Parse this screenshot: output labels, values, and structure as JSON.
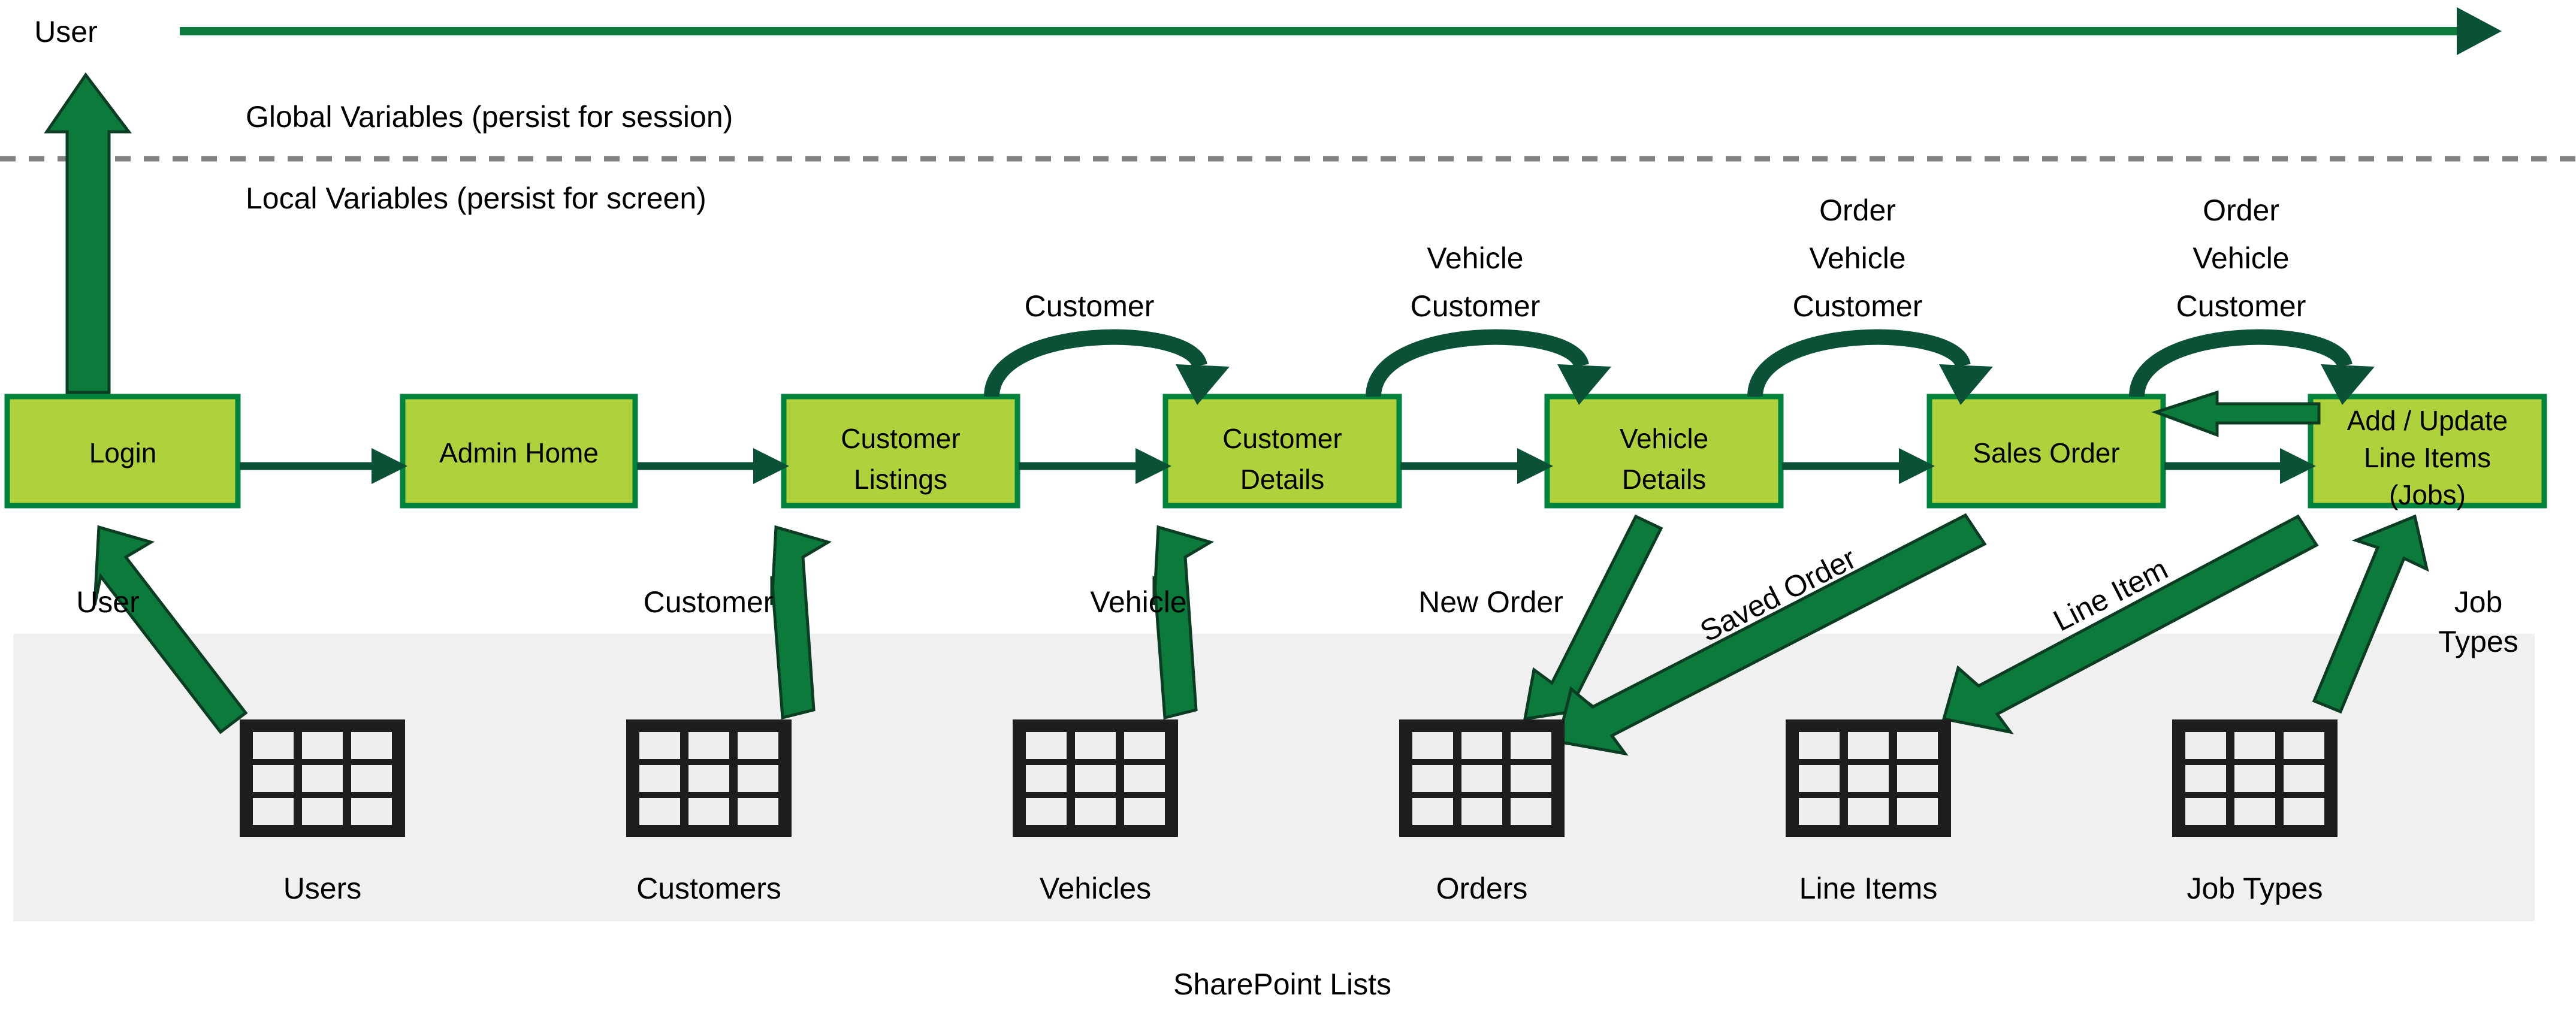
{
  "diagram": {
    "title": "SharePoint Lists",
    "top_actor_label": "User",
    "zones": {
      "global": "Global Variables (persist for session)",
      "local": "Local Variables (persist for screen)"
    },
    "screens": [
      {
        "id": "login",
        "lines": [
          "Login"
        ]
      },
      {
        "id": "admin-home",
        "lines": [
          "Admin Home"
        ]
      },
      {
        "id": "customer-listings",
        "lines": [
          "Customer",
          "Listings"
        ]
      },
      {
        "id": "customer-details",
        "lines": [
          "Customer",
          "Details"
        ]
      },
      {
        "id": "vehicle-details",
        "lines": [
          "Vehicle",
          "Details"
        ]
      },
      {
        "id": "sales-order",
        "lines": [
          "Sales Order"
        ]
      },
      {
        "id": "line-items",
        "lines": [
          "Add / Update",
          "Line Items",
          "(Jobs)"
        ]
      }
    ],
    "variable_passes": [
      {
        "id": "pass-customer",
        "lines": [
          "Customer"
        ]
      },
      {
        "id": "pass-vehicle-customer",
        "lines": [
          "Vehicle",
          "Customer"
        ]
      },
      {
        "id": "pass-order-vehicle-customer-1",
        "lines": [
          "Order",
          "Vehicle",
          "Customer"
        ]
      },
      {
        "id": "pass-order-vehicle-customer-2",
        "lines": [
          "Order",
          "Vehicle",
          "Customer"
        ]
      }
    ],
    "data_flows": [
      {
        "id": "flow-user",
        "lines": [
          "User"
        ]
      },
      {
        "id": "flow-customer",
        "lines": [
          "Customer"
        ]
      },
      {
        "id": "flow-vehicle",
        "lines": [
          "Vehicle"
        ]
      },
      {
        "id": "flow-new-order",
        "lines": [
          "New Order"
        ]
      },
      {
        "id": "flow-saved-order",
        "lines": [
          "Saved Order"
        ]
      },
      {
        "id": "flow-line-item",
        "lines": [
          "Line Item"
        ]
      },
      {
        "id": "flow-job-types",
        "lines": [
          "Job",
          "Types"
        ]
      }
    ],
    "lists": [
      {
        "id": "list-users",
        "label": "Users"
      },
      {
        "id": "list-customers",
        "label": "Customers"
      },
      {
        "id": "list-vehicles",
        "label": "Vehicles"
      },
      {
        "id": "list-orders",
        "label": "Orders"
      },
      {
        "id": "list-line-items",
        "label": "Line Items"
      },
      {
        "id": "list-job-types",
        "label": "Job Types"
      }
    ],
    "colors": {
      "screen_fill": "#AFD23C",
      "screen_border": "#00843D",
      "connector_dark_green": "#0B5135",
      "flow_green": "#0B7A3B",
      "band_gray": "#F0F0F0",
      "divider_gray": "#808080",
      "list_icon": "#1D1D1D"
    }
  }
}
